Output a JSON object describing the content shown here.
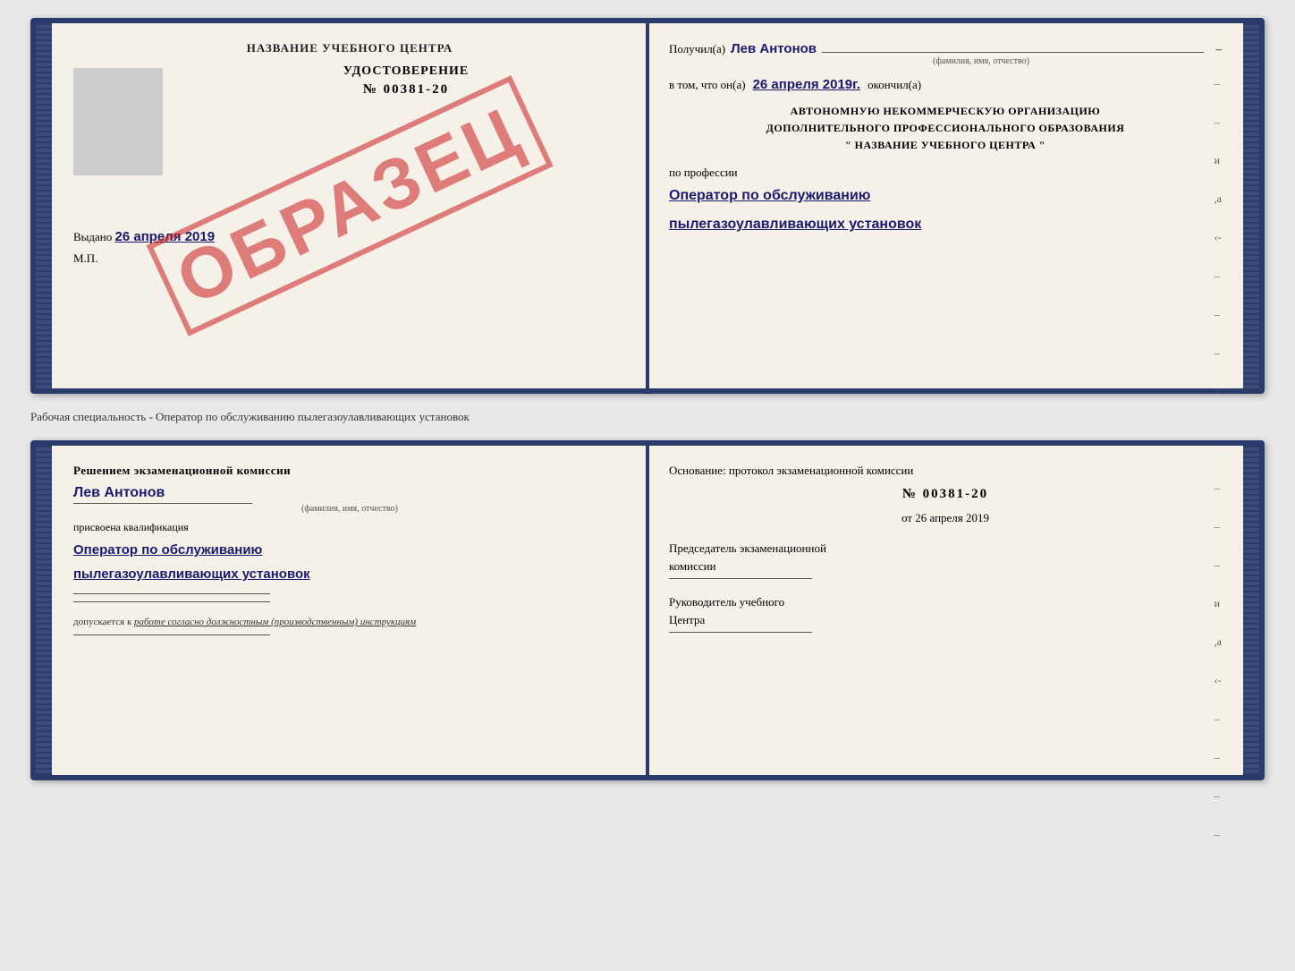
{
  "book1": {
    "left": {
      "title": "НАЗВАНИЕ УЧЕБНОГО ЦЕНТРА",
      "doc_type": "УДОСТОВЕРЕНИЕ",
      "doc_number": "№ 00381-20",
      "issued_label": "Выдано",
      "issued_date": "26 апреля 2019",
      "mp_label": "М.П.",
      "sample_stamp": "ОБРАЗЕЦ"
    },
    "right": {
      "received_label": "Получил(а)",
      "received_name": "Лев Антонов",
      "fio_label": "(фамилия, имя, отчество)",
      "vtom_label": "в том, что он(а)",
      "vtom_date": "26 апреля 2019г.",
      "okonchil_label": "окончил(а)",
      "org_line1": "АВТОНОМНУЮ НЕКОММЕРЧЕСКУЮ ОРГАНИЗАЦИЮ",
      "org_line2": "ДОПОЛНИТЕЛЬНОГО ПРОФЕССИОНАЛЬНОГО ОБРАЗОВАНИЯ",
      "org_line3": "\"  НАЗВАНИЕ УЧЕБНОГО ЦЕНТРА  \"",
      "po_professii_label": "по профессии",
      "profession_line1": "Оператор по обслуживанию",
      "profession_line2": "пылегазоулавливающих установок",
      "side_marks": [
        "–",
        "–",
        "и",
        ",а",
        "‹-",
        "–",
        "–",
        "–",
        "–"
      ]
    }
  },
  "separator": {
    "text": "Рабочая специальность - Оператор по обслуживанию пылегазоулавливающих установок"
  },
  "book2": {
    "left": {
      "komissia_text": "Решением экзаменационной комиссии",
      "name": "Лев Антонов",
      "fio_label": "(фамилия, имя, отчество)",
      "prisvoyena_label": "присвоена квалификация",
      "kvalif_line1": "Оператор по обслуживанию",
      "kvalif_line2": "пылегазоулавливающих установок",
      "dopusk_label": "допускается к",
      "dopusk_text": "работе согласно должностным (производственным) инструкциям"
    },
    "right": {
      "osnovanie_label": "Основание: протокол экзаменационной комиссии",
      "protocol_number": "№  00381-20",
      "ot_label": "от",
      "ot_date": "26 апреля 2019",
      "predsedatel_line1": "Председатель экзаменационной",
      "predsedatel_line2": "комиссии",
      "rukovoditel_line1": "Руководитель учебного",
      "rukovoditel_line2": "Центра",
      "side_marks": [
        "–",
        "–",
        "–",
        "и",
        ",а",
        "‹-",
        "–",
        "–",
        "–",
        "–"
      ]
    }
  }
}
